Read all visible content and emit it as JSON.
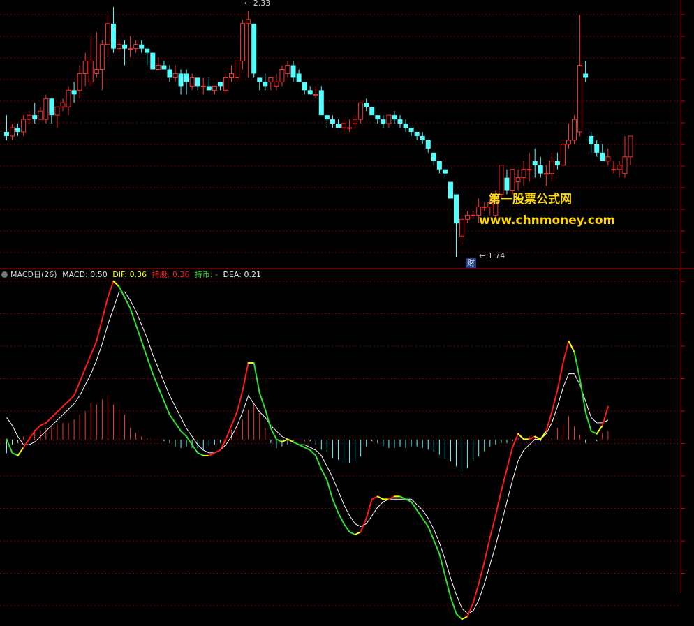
{
  "macd_header": {
    "name": "MACD日(26)",
    "macd": "MACD: 0.50",
    "dif": "DIF: 0.36",
    "hold": "持股: 0.36",
    "coin": "持币: -",
    "dea": "DEA: 0.21"
  },
  "watermark": {
    "line1": "第一股票公式网",
    "line2": "www.chnmoney.com"
  },
  "annotations": {
    "high": "2.33",
    "low": "1.74",
    "event": "财"
  },
  "colors": {
    "up": "#ff3232",
    "down": "#54ffff",
    "dif_up": "#ff1a1a",
    "dif_down": "#2fe030",
    "dif_turn": "#ffff00",
    "dea": "#ffffff",
    "grid": "#7a0000",
    "divider": "#c00000",
    "watermark": "#ffd800"
  },
  "chart_data": [
    {
      "type": "candlestick",
      "title": "",
      "series": [
        {
          "name": "price",
          "ohlc": [
            [
              2.04,
              2.08,
              2.02,
              2.03
            ],
            [
              2.03,
              2.06,
              2.02,
              2.05
            ],
            [
              2.05,
              2.06,
              2.03,
              2.04
            ],
            [
              2.04,
              2.08,
              2.03,
              2.07
            ],
            [
              2.07,
              2.09,
              2.06,
              2.08
            ],
            [
              2.08,
              2.11,
              2.06,
              2.07
            ],
            [
              2.07,
              2.1,
              2.07,
              2.09
            ],
            [
              2.07,
              2.13,
              2.06,
              2.12
            ],
            [
              2.12,
              2.12,
              2.06,
              2.08
            ],
            [
              2.08,
              2.1,
              2.05,
              2.1
            ],
            [
              2.1,
              2.12,
              2.09,
              2.11
            ],
            [
              2.1,
              2.15,
              2.08,
              2.14
            ],
            [
              2.14,
              2.16,
              2.11,
              2.13
            ],
            [
              2.14,
              2.2,
              2.12,
              2.18
            ],
            [
              2.18,
              2.23,
              2.15,
              2.21
            ],
            [
              2.16,
              2.27,
              2.15,
              2.21
            ],
            [
              2.18,
              2.28,
              2.17,
              2.19
            ],
            [
              2.19,
              2.26,
              2.14,
              2.25
            ],
            [
              2.25,
              2.32,
              2.22,
              2.3
            ],
            [
              2.3,
              2.34,
              2.23,
              2.24
            ],
            [
              2.24,
              2.26,
              2.23,
              2.25
            ],
            [
              2.25,
              2.26,
              2.2,
              2.24
            ],
            [
              2.24,
              2.27,
              2.22,
              2.24
            ],
            [
              2.24,
              2.26,
              2.23,
              2.25
            ],
            [
              2.25,
              2.26,
              2.23,
              2.24
            ],
            [
              2.24,
              2.24,
              2.2,
              2.23
            ],
            [
              2.23,
              2.23,
              2.2,
              2.19
            ],
            [
              2.19,
              2.22,
              2.19,
              2.2
            ],
            [
              2.2,
              2.21,
              2.19,
              2.19
            ],
            [
              2.19,
              2.2,
              2.16,
              2.17
            ],
            [
              2.17,
              2.2,
              2.16,
              2.18
            ],
            [
              2.18,
              2.19,
              2.13,
              2.15
            ],
            [
              2.18,
              2.19,
              2.13,
              2.16
            ],
            [
              2.15,
              2.18,
              2.14,
              2.17
            ],
            [
              2.17,
              2.17,
              2.14,
              2.15
            ],
            [
              2.15,
              2.17,
              2.13,
              2.15
            ],
            [
              2.15,
              2.17,
              2.14,
              2.14
            ],
            [
              2.14,
              2.15,
              2.13,
              2.15
            ],
            [
              2.16,
              2.16,
              2.14,
              2.15
            ],
            [
              2.14,
              2.18,
              2.13,
              2.17
            ],
            [
              2.17,
              2.2,
              2.16,
              2.18
            ],
            [
              2.17,
              2.21,
              2.16,
              2.21
            ],
            [
              2.21,
              2.31,
              2.19,
              2.3
            ],
            [
              2.3,
              2.33,
              2.17,
              2.31
            ],
            [
              2.3,
              2.3,
              2.17,
              2.18
            ],
            [
              2.17,
              2.17,
              2.14,
              2.16
            ],
            [
              2.16,
              2.18,
              2.14,
              2.15
            ],
            [
              2.16,
              2.17,
              2.14,
              2.17
            ],
            [
              2.15,
              2.18,
              2.14,
              2.16
            ],
            [
              2.16,
              2.2,
              2.15,
              2.19
            ],
            [
              2.18,
              2.21,
              2.17,
              2.2
            ],
            [
              2.2,
              2.21,
              2.16,
              2.17
            ],
            [
              2.18,
              2.19,
              2.16,
              2.16
            ],
            [
              2.16,
              2.16,
              2.13,
              2.14
            ],
            [
              2.14,
              2.15,
              2.13,
              2.13
            ],
            [
              2.13,
              2.15,
              2.12,
              2.13
            ],
            [
              2.14,
              2.15,
              2.08,
              2.08
            ],
            [
              2.08,
              2.08,
              2.05,
              2.07
            ],
            [
              2.07,
              2.08,
              2.05,
              2.06
            ],
            [
              2.06,
              2.07,
              2.05,
              2.05
            ],
            [
              2.05,
              2.07,
              2.04,
              2.06
            ],
            [
              2.05,
              2.07,
              2.04,
              2.05
            ],
            [
              2.06,
              2.08,
              2.05,
              2.07
            ],
            [
              2.07,
              2.11,
              2.06,
              2.11
            ],
            [
              2.11,
              2.12,
              2.09,
              2.1
            ],
            [
              2.1,
              2.1,
              2.08,
              2.08
            ],
            [
              2.08,
              2.08,
              2.06,
              2.07
            ],
            [
              2.07,
              2.08,
              2.05,
              2.06
            ],
            [
              2.06,
              2.08,
              2.05,
              2.08
            ],
            [
              2.08,
              2.09,
              2.06,
              2.07
            ],
            [
              2.07,
              2.08,
              2.05,
              2.06
            ],
            [
              2.06,
              2.07,
              2.04,
              2.05
            ],
            [
              2.05,
              2.05,
              2.03,
              2.04
            ],
            [
              2.04,
              2.04,
              2.02,
              2.03
            ],
            [
              2.03,
              2.04,
              2.01,
              2.02
            ],
            [
              2.02,
              2.02,
              1.99,
              2.0
            ],
            [
              1.99,
              1.99,
              1.96,
              1.97
            ],
            [
              1.97,
              1.97,
              1.94,
              1.95
            ],
            [
              1.95,
              1.95,
              1.93,
              1.94
            ],
            [
              1.92,
              1.92,
              1.88,
              1.88
            ],
            [
              1.89,
              1.89,
              1.74,
              1.82
            ],
            [
              1.79,
              1.84,
              1.77,
              1.83
            ],
            [
              1.83,
              1.85,
              1.82,
              1.84
            ],
            [
              1.84,
              1.85,
              1.83,
              1.84
            ],
            [
              1.84,
              1.88,
              1.82,
              1.86
            ],
            [
              1.86,
              1.87,
              1.85,
              1.86
            ],
            [
              1.86,
              1.88,
              1.84,
              1.87
            ],
            [
              1.84,
              1.9,
              1.83,
              1.89
            ],
            [
              1.89,
              1.96,
              1.88,
              1.96
            ],
            [
              1.93,
              1.95,
              1.89,
              1.9
            ],
            [
              1.9,
              1.95,
              1.89,
              1.95
            ],
            [
              1.92,
              1.95,
              1.9,
              1.93
            ],
            [
              1.93,
              1.97,
              1.91,
              1.95
            ],
            [
              1.95,
              1.99,
              1.92,
              1.95
            ],
            [
              1.97,
              2.0,
              1.93,
              1.96
            ],
            [
              1.96,
              1.98,
              1.93,
              1.94
            ],
            [
              1.94,
              1.96,
              1.91,
              1.94
            ],
            [
              1.94,
              1.99,
              1.92,
              1.97
            ],
            [
              1.97,
              1.99,
              1.95,
              1.96
            ],
            [
              1.96,
              2.02,
              1.96,
              2.01
            ],
            [
              2.01,
              2.06,
              2.0,
              2.02
            ],
            [
              2.02,
              2.08,
              2.01,
              2.07
            ],
            [
              2.04,
              2.32,
              2.03,
              2.2
            ],
            [
              2.18,
              2.21,
              2.16,
              2.17
            ],
            [
              2.03,
              2.04,
              1.99,
              2.01
            ],
            [
              2.01,
              2.02,
              1.98,
              1.99
            ],
            [
              1.99,
              2.01,
              1.97,
              1.97
            ],
            [
              1.97,
              2.0,
              1.96,
              1.98
            ],
            [
              1.95,
              1.97,
              1.94,
              1.95
            ],
            [
              1.95,
              1.97,
              1.93,
              1.96
            ],
            [
              1.94,
              2.03,
              1.93,
              1.98
            ],
            [
              1.98,
              2.03,
              1.96,
              2.03
            ]
          ]
        }
      ],
      "annotations": [
        {
          "label": "2.33",
          "value": 2.33,
          "kind": "high"
        },
        {
          "label": "1.74",
          "value": 1.74,
          "kind": "low"
        }
      ]
    },
    {
      "type": "line",
      "title": "MACD日(26)",
      "series": [
        {
          "name": "DIF",
          "values": [
            0.0,
            -0.05,
            -0.06,
            -0.03,
            0.0,
            0.03,
            0.05,
            0.06,
            0.08,
            0.1,
            0.12,
            0.14,
            0.16,
            0.21,
            0.26,
            0.31,
            0.36,
            0.44,
            0.52,
            0.58,
            0.56,
            0.52,
            0.48,
            0.42,
            0.36,
            0.3,
            0.24,
            0.19,
            0.14,
            0.09,
            0.06,
            0.03,
            0.01,
            -0.02,
            -0.05,
            -0.06,
            -0.06,
            -0.05,
            -0.04,
            0.0,
            0.05,
            0.1,
            0.18,
            0.28,
            0.28,
            0.17,
            0.11,
            0.04,
            0.0,
            -0.01,
            0.0,
            -0.01,
            -0.02,
            -0.03,
            -0.04,
            -0.06,
            -0.11,
            -0.15,
            -0.22,
            -0.27,
            -0.31,
            -0.34,
            -0.35,
            -0.34,
            -0.29,
            -0.22,
            -0.21,
            -0.22,
            -0.22,
            -0.21,
            -0.21,
            -0.22,
            -0.23,
            -0.26,
            -0.29,
            -0.32,
            -0.37,
            -0.42,
            -0.5,
            -0.58,
            -0.64,
            -0.66,
            -0.65,
            -0.6,
            -0.53,
            -0.45,
            -0.36,
            -0.28,
            -0.19,
            -0.11,
            -0.03,
            0.02,
            0.0,
            0.0,
            0.01,
            0.0,
            0.03,
            0.1,
            0.18,
            0.28,
            0.36,
            0.32,
            0.22,
            0.1,
            0.03,
            0.02,
            0.05,
            0.12
          ]
        },
        {
          "name": "DEA",
          "values": [
            0.08,
            0.05,
            0.01,
            -0.02,
            -0.02,
            -0.01,
            0.01,
            0.03,
            0.05,
            0.07,
            0.09,
            0.11,
            0.13,
            0.16,
            0.2,
            0.24,
            0.29,
            0.35,
            0.42,
            0.48,
            0.54,
            0.54,
            0.51,
            0.47,
            0.42,
            0.37,
            0.31,
            0.26,
            0.21,
            0.16,
            0.12,
            0.08,
            0.04,
            0.01,
            -0.02,
            -0.04,
            -0.05,
            -0.05,
            -0.04,
            -0.02,
            0.01,
            0.05,
            0.1,
            0.16,
            0.13,
            0.1,
            0.08,
            0.05,
            0.03,
            0.01,
            0.0,
            -0.01,
            -0.02,
            -0.02,
            -0.03,
            -0.04,
            -0.06,
            -0.1,
            -0.14,
            -0.19,
            -0.24,
            -0.28,
            -0.31,
            -0.32,
            -0.31,
            -0.28,
            -0.25,
            -0.23,
            -0.22,
            -0.22,
            -0.22,
            -0.22,
            -0.22,
            -0.24,
            -0.26,
            -0.29,
            -0.33,
            -0.38,
            -0.44,
            -0.51,
            -0.57,
            -0.62,
            -0.64,
            -0.63,
            -0.59,
            -0.53,
            -0.46,
            -0.39,
            -0.31,
            -0.23,
            -0.15,
            -0.08,
            -0.04,
            -0.02,
            0.0,
            0.0,
            0.02,
            0.06,
            0.12,
            0.19,
            0.24,
            0.24,
            0.2,
            0.14,
            0.08,
            0.06,
            0.06,
            0.07
          ]
        },
        {
          "name": "MACD",
          "type": "bar",
          "values": [
            -0.08,
            -0.03,
            -0.02,
            0.02,
            0.03,
            0.06,
            0.05,
            0.07,
            0.08,
            0.09,
            0.1,
            0.1,
            0.12,
            0.15,
            0.17,
            0.22,
            0.21,
            0.24,
            0.26,
            0.21,
            0.18,
            0.15,
            0.07,
            0.04,
            0.02,
            0.01,
            0.0,
            0.0,
            -0.01,
            -0.02,
            -0.04,
            -0.05,
            -0.04,
            -0.05,
            -0.05,
            -0.06,
            -0.04,
            -0.03,
            -0.02,
            0.02,
            0.06,
            0.09,
            0.12,
            0.18,
            0.21,
            0.16,
            0.07,
            -0.02,
            -0.05,
            -0.04,
            -0.03,
            -0.02,
            0.0,
            -0.01,
            -0.01,
            -0.03,
            -0.06,
            -0.07,
            -0.11,
            -0.12,
            -0.14,
            -0.14,
            -0.13,
            -0.1,
            -0.04,
            -0.01,
            -0.02,
            -0.04,
            -0.05,
            -0.05,
            -0.04,
            -0.05,
            -0.04,
            -0.04,
            -0.05,
            -0.06,
            -0.07,
            -0.09,
            -0.11,
            -0.13,
            -0.16,
            -0.19,
            -0.17,
            -0.13,
            -0.1,
            -0.07,
            -0.04,
            -0.03,
            -0.02,
            -0.02,
            -0.01,
            0.01,
            0.0,
            0.02,
            0.02,
            -0.01,
            0.0,
            0.01,
            0.07,
            0.09,
            0.14,
            0.08,
            0.03,
            -0.02,
            0.0,
            -0.01,
            0.04,
            0.05
          ]
        }
      ],
      "legend": [
        "MACD: 0.50",
        "DIF: 0.36",
        "持股: 0.36",
        "持币: -",
        "DEA: 0.21"
      ]
    }
  ]
}
